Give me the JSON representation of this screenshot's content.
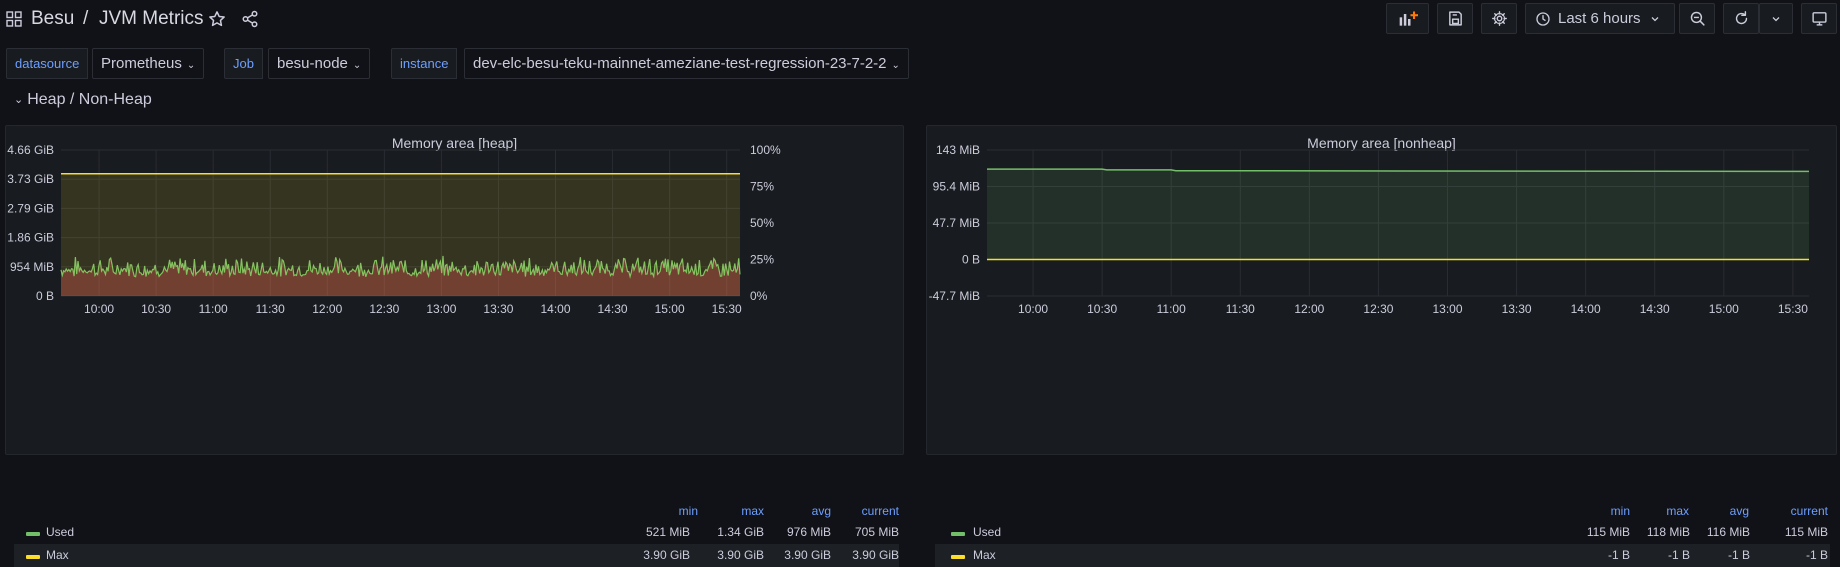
{
  "header": {
    "folder": "Besu",
    "separator": "/",
    "title": "JVM Metrics",
    "time_range": "Last 6 hours"
  },
  "variables": [
    {
      "label": "datasource",
      "value": "Prometheus"
    },
    {
      "label": "Job",
      "value": "besu-node"
    },
    {
      "label": "instance",
      "value": "dev-elc-besu-teku-mainnet-ameziane-test-regression-23-7-2-2"
    }
  ],
  "row": {
    "title": "Heap / Non-Heap"
  },
  "colors": {
    "used": "#73bf69",
    "max": "#fade2a",
    "accent": "#6e9fff"
  },
  "legend_columns": [
    "min",
    "max",
    "avg",
    "current"
  ],
  "panels": [
    {
      "title": "Memory area [heap]",
      "legend": [
        {
          "name": "Used",
          "min": "521 MiB",
          "max": "1.34 GiB",
          "avg": "976 MiB",
          "current": "705 MiB"
        },
        {
          "name": "Max",
          "min": "3.90 GiB",
          "max": "3.90 GiB",
          "avg": "3.90 GiB",
          "current": "3.90 GiB"
        }
      ]
    },
    {
      "title": "Memory area [nonheap]",
      "legend": [
        {
          "name": "Used",
          "min": "115 MiB",
          "max": "118 MiB",
          "avg": "116 MiB",
          "current": "115 MiB"
        },
        {
          "name": "Max",
          "min": "-1 B",
          "max": "-1 B",
          "avg": "-1 B",
          "current": "-1 B"
        }
      ]
    }
  ],
  "chart_data": [
    {
      "type": "area",
      "title": "Memory area [heap]",
      "x": [
        "10:00",
        "10:30",
        "11:00",
        "11:30",
        "12:00",
        "12:30",
        "13:00",
        "13:30",
        "14:00",
        "14:30",
        "15:00",
        "15:30"
      ],
      "x_range": [
        "09:40",
        "15:37"
      ],
      "ylim": [
        0,
        4.66
      ],
      "y_unit": "GiB",
      "y_ticks": [
        "0 B",
        "954 MiB",
        "1.86 GiB",
        "2.79 GiB",
        "3.73 GiB",
        "4.66 GiB"
      ],
      "y2_ticks": [
        "0%",
        "25%",
        "50%",
        "75%",
        "100%"
      ],
      "series": [
        {
          "name": "Used",
          "min": 0.51,
          "max": 1.34,
          "avg": 0.95,
          "current": 0.69
        },
        {
          "name": "Max",
          "value": 3.9
        }
      ]
    },
    {
      "type": "area",
      "title": "Memory area [nonheap]",
      "x": [
        "10:00",
        "10:30",
        "11:00",
        "11:30",
        "12:00",
        "12:30",
        "13:00",
        "13:30",
        "14:00",
        "14:30",
        "15:00",
        "15:30"
      ],
      "x_range": [
        "09:40",
        "15:37"
      ],
      "ylim": [
        -47.7,
        143
      ],
      "y_unit": "MiB",
      "y_ticks": [
        "-47.7 MiB",
        "0 B",
        "47.7 MiB",
        "95.4 MiB",
        "143 MiB"
      ],
      "series": [
        {
          "name": "Used",
          "points": [
            [
              "09:40",
              118
            ],
            [
              "10:30",
              118
            ],
            [
              "10:32",
              117
            ],
            [
              "11:00",
              117
            ],
            [
              "11:02",
              116
            ],
            [
              "15:37",
              115
            ]
          ]
        },
        {
          "name": "Max",
          "value": 0
        }
      ]
    }
  ]
}
